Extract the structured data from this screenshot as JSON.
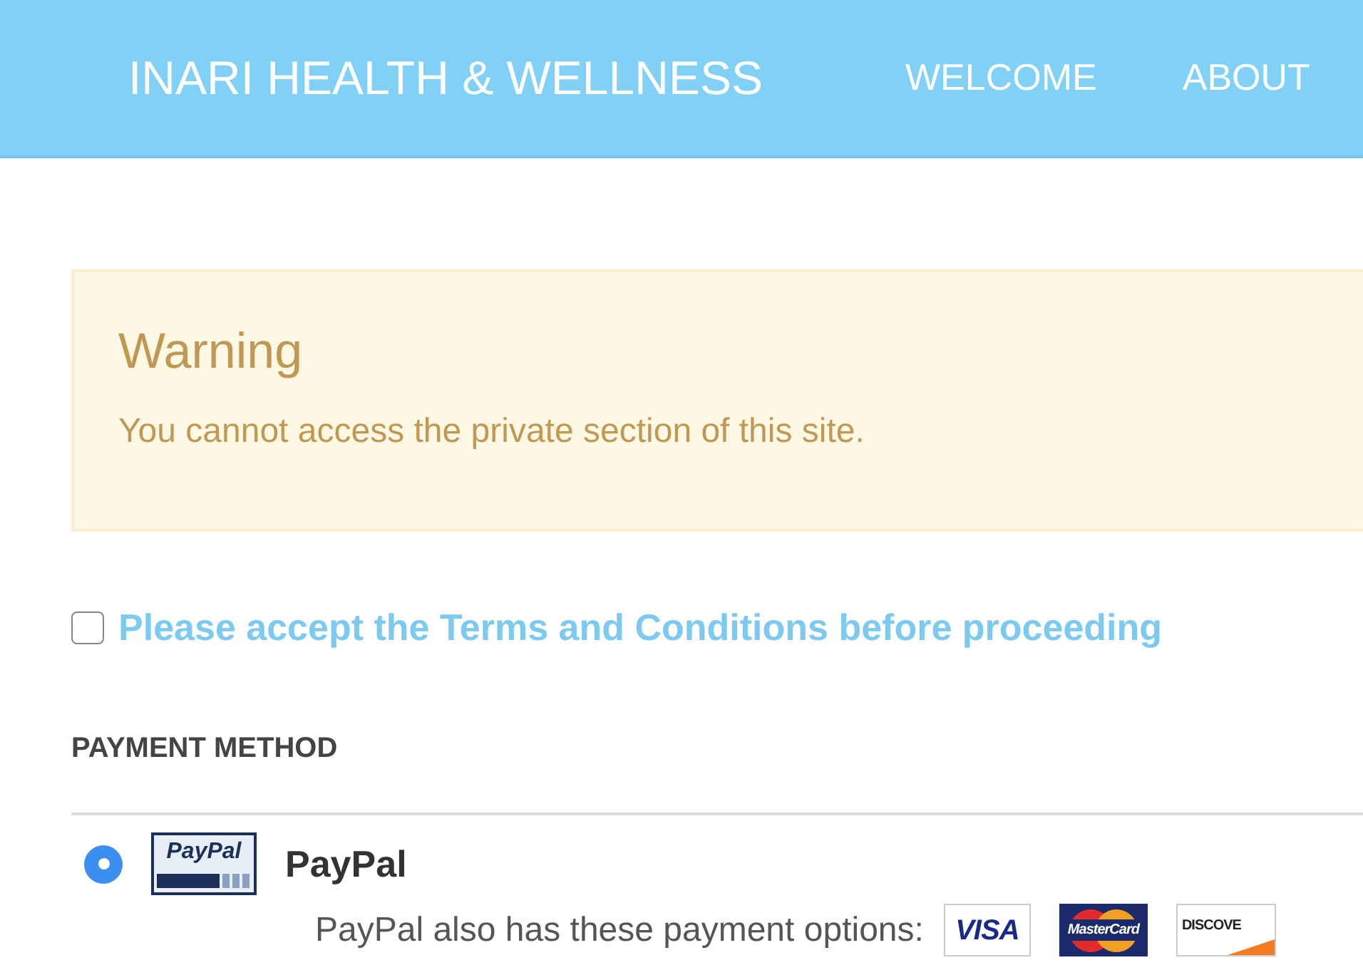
{
  "header": {
    "brand": "INARI HEALTH & WELLNESS",
    "nav": [
      {
        "label": "WELCOME"
      },
      {
        "label": "ABOUT"
      }
    ]
  },
  "alert": {
    "kind": "warning",
    "title": "Warning",
    "message": "You cannot access the private section of this site."
  },
  "terms": {
    "checked": false,
    "label": "Please accept the Terms and Conditions before proceeding"
  },
  "payment": {
    "heading": "PAYMENT METHOD",
    "methods": [
      {
        "name": "PayPal",
        "logo": "PayPal",
        "selected": true,
        "note": "PayPal also has these payment options:",
        "cards": [
          {
            "kind": "visa",
            "label": "VISA"
          },
          {
            "kind": "mastercard",
            "label": "MasterCard"
          },
          {
            "kind": "discover",
            "label": "DISCOVE"
          }
        ]
      }
    ]
  }
}
